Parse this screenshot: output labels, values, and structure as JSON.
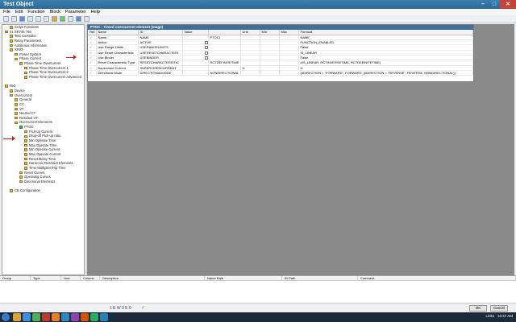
{
  "window": {
    "title": "Test Object"
  },
  "menu": [
    "File",
    "Edit",
    "Function",
    "Block",
    "Parameter",
    "Help"
  ],
  "tree": [
    {
      "label": "Script Functions",
      "indent": 1
    },
    {
      "label": "01 SR745 760",
      "indent": 0
    },
    {
      "label": "Test Controller",
      "indent": 1
    },
    {
      "label": "Relay Parameters",
      "indent": 1
    },
    {
      "label": "Additional Information",
      "indent": 1
    },
    {
      "label": "XRIO",
      "indent": 1
    },
    {
      "label": "Power System",
      "indent": 2
    },
    {
      "label": "Phase Current",
      "indent": 2
    },
    {
      "label": "Phase Time Overcurrent",
      "indent": 3
    },
    {
      "label": "Phase Time Overcurrent 1",
      "indent": 4
    },
    {
      "label": "Phase Time Overcurrent 2",
      "indent": 4
    },
    {
      "label": "Phase Time Overcurrent Advanced",
      "indent": 4
    },
    {
      "label": "",
      "indent": 0
    },
    {
      "label": "RIO",
      "indent": 0
    },
    {
      "label": "Device",
      "indent": 1
    },
    {
      "label": "Overcurrent",
      "indent": 1
    },
    {
      "label": "General",
      "indent": 2
    },
    {
      "label": "CT",
      "indent": 2
    },
    {
      "label": "VT",
      "indent": 2
    },
    {
      "label": "Neutral CT",
      "indent": 2
    },
    {
      "label": "Residual VT",
      "indent": 2
    },
    {
      "label": "Overcurrent Elements",
      "indent": 2
    },
    {
      "label": "PTOC",
      "indent": 3,
      "selected": true
    },
    {
      "label": "Pick-up Current",
      "indent": 4
    },
    {
      "label": "Drop-off Pick-up ratio",
      "indent": 4
    },
    {
      "label": "Min Operate Time",
      "indent": 4
    },
    {
      "label": "Max Operate Time",
      "indent": 4
    },
    {
      "label": "Min Operate Current",
      "indent": 4
    },
    {
      "label": "Max Operate Current",
      "indent": 4
    },
    {
      "label": "Reset Delay Time",
      "indent": 4
    },
    {
      "label": "Harmonic Restraint Elements",
      "indent": 4
    },
    {
      "label": "Time Multiplier/Trip Time",
      "indent": 4
    },
    {
      "label": "Reset Curves",
      "indent": 3
    },
    {
      "label": "Operating Curves",
      "indent": 3
    },
    {
      "label": "Directional Elements",
      "indent": 3
    },
    {
      "label": "",
      "indent": 0
    },
    {
      "label": "CB Configuration",
      "indent": 1
    }
  ],
  "panel": {
    "title": "PTOC - Timed overcurrent element (stage)",
    "columns": [
      "Ref.",
      "Name",
      "ID",
      "Value",
      "",
      "Unit",
      "Min",
      "Max",
      "Formula"
    ],
    "rows": [
      {
        "name": "Name",
        "id": "NAME",
        "value": "",
        "checkbox": false,
        "val2": "PTOC1",
        "unit": "",
        "formula": "NAME"
      },
      {
        "name": "Active",
        "id": "ACTIVE",
        "value": "",
        "checkbox": true,
        "val2": "",
        "unit": "",
        "formula": "FUNCTION_ENABLED"
      },
      {
        "name": "Use Range Limits",
        "id": "USERANGELIMITS",
        "value": "",
        "checkbox": true,
        "val2": "",
        "unit": "",
        "formula": "False"
      },
      {
        "name": "Use Reset Characteristic",
        "id": "USERESETCHARACTERI",
        "value": "",
        "checkbox": true,
        "val2": "",
        "unit": "",
        "formula": "IS_LINEAR"
      },
      {
        "name": "Use Binder",
        "id": "USEBINDER",
        "value": "",
        "checkbox": true,
        "val2": "",
        "unit": "",
        "formula": "False"
      },
      {
        "name": "Reset Characteristic Type",
        "id": "RESETCHARACTERISTIC",
        "value": "",
        "checkbox": false,
        "val2": "RCTDEFINITETIME",
        "unit": "",
        "formula": "#IS_LINEAR, RCTINVERSETIME, RCTDEFINITETIME)"
      },
      {
        "name": "Supervised Current",
        "id": "SUPERVISEDCURRENT",
        "value": "",
        "checkbox": false,
        "val2": "",
        "unit": "IL",
        "formula": "IL"
      },
      {
        "name": "Directional Mode",
        "id": "DIRECTIONALMODE",
        "value": "",
        "checkbox": false,
        "val2": "NONDIRECTIONAL",
        "unit": "",
        "formula": "(#DIRECTION = \"FORWARD\", FORWARD, (#DIRECTION = \"REVERSE\", REVERSE, NONDIRECTIONAL))"
      }
    ]
  },
  "bottom_columns": [
    "Group",
    "Type",
    "Line",
    "Column",
    "Description",
    "Name Path",
    "ID Path",
    "Comment"
  ],
  "status": {
    "text": "1 E W 0 E 0",
    "ok_label": "OK",
    "cancel_label": "Cancel"
  },
  "tray": {
    "lang": "Links",
    "time": "10:47 AM"
  }
}
